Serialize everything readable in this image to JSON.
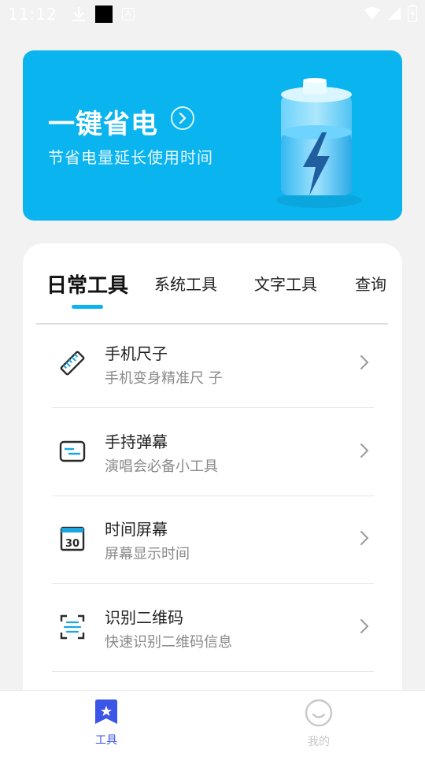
{
  "status_bar": {
    "time": "11:12",
    "icons": [
      "download-icon",
      "notification-square-icon",
      "a-icon",
      "wifi-icon",
      "signal-icon",
      "battery-icon"
    ]
  },
  "banner": {
    "title": "一键省电",
    "subtitle": "节省电量延长使用时间",
    "background_color": "#0ab4ef"
  },
  "tabs": [
    {
      "label": "日常工具",
      "active": true
    },
    {
      "label": "系统工具",
      "active": false
    },
    {
      "label": "文字工具",
      "active": false
    },
    {
      "label": "查询",
      "active": false
    }
  ],
  "tools": [
    {
      "title": "手机尺子",
      "subtitle": "手机变身精准尺 子",
      "icon": "ruler-icon"
    },
    {
      "title": "手持弹幕",
      "subtitle": "演唱会必备小工具",
      "icon": "screen-text-icon"
    },
    {
      "title": "时间屏幕",
      "subtitle": "屏幕显示时间",
      "icon": "calendar-30-icon"
    },
    {
      "title": "识别二维码",
      "subtitle": "快速识别二维码信息",
      "icon": "scan-qr-icon"
    }
  ],
  "bottom_nav": {
    "items": [
      {
        "label": "工具",
        "icon": "star-bookmark-icon",
        "active": true
      },
      {
        "label": "我的",
        "icon": "smile-face-icon",
        "active": false
      }
    ],
    "active_color": "#3b55e6",
    "inactive_color": "#c8c8c8"
  }
}
